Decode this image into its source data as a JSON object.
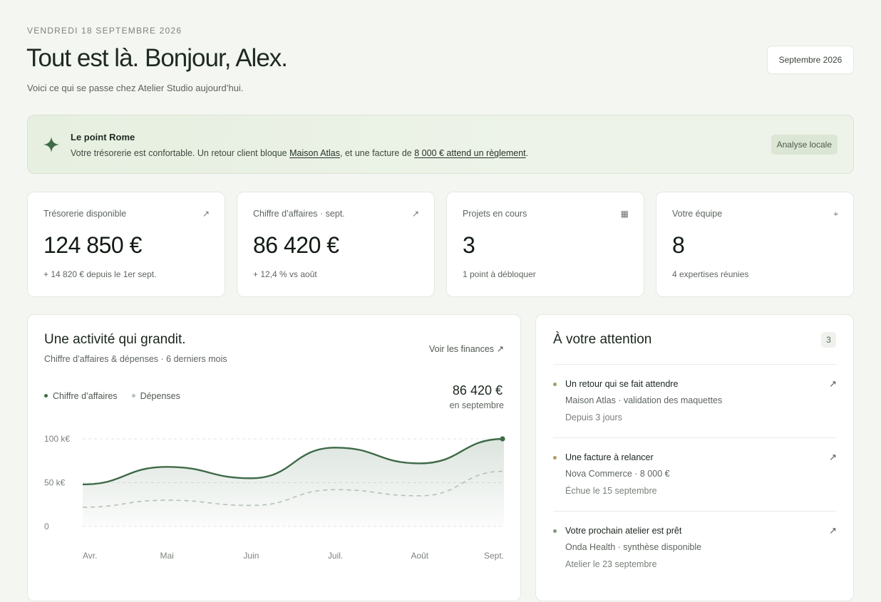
{
  "header": {
    "date": "VENDREDI 18 SEPTEMBRE 2026",
    "title": "Tout est là. Bonjour, Alex.",
    "subtitle": "Voici ce qui se passe chez Atelier Studio aujourd’hui.",
    "month_button": "Septembre 2026"
  },
  "insight": {
    "icon": "sparkle-icon",
    "title": "Le point Rome",
    "text_before": "Votre trésorerie est confortable. Un retour client bloque ",
    "link_client": "Maison Atlas",
    "text_middle": ", et une facture de ",
    "link_invoice": "8 000 € attend un règlement",
    "text_after": ".",
    "badge": "Analyse locale"
  },
  "stats": [
    {
      "label": "Trésorerie disponible",
      "icon": "↗",
      "value": "124 850 €",
      "note": "+ 14 820 € depuis le 1er sept."
    },
    {
      "label": "Chiffre d’affaires · sept.",
      "icon": "↗",
      "value": "86 420 €",
      "note": "+ 12,4 % vs août"
    },
    {
      "label": "Projets en cours",
      "icon": "▦",
      "value": "3",
      "note": "1 point à débloquer"
    },
    {
      "label": "Votre équipe",
      "icon": "⌖",
      "value": "8",
      "note": "4 expertises réunies"
    }
  ],
  "activity": {
    "title": "Une activité qui grandit.",
    "subtitle": "Chiffre d’affaires & dépenses · 6 derniers mois",
    "link": "Voir les finances ↗",
    "legend_revenue": "Chiffre d’affaires",
    "legend_expenses": "Dépenses",
    "total": "86 420 €",
    "total_sub": "en septembre"
  },
  "chart_data": {
    "type": "area",
    "categories": [
      "Avr.",
      "Mai",
      "Juin",
      "Juil.",
      "Août",
      "Sept."
    ],
    "y_ticks": [
      "0",
      "50 k€",
      "100 k€"
    ],
    "ylim": [
      0,
      100
    ],
    "series": [
      {
        "name": "Chiffre d’affaires",
        "values": [
          48,
          68,
          55,
          90,
          72,
          100
        ],
        "color": "#3e6a48"
      },
      {
        "name": "Dépenses",
        "values": [
          22,
          30,
          24,
          42,
          35,
          63
        ],
        "color": "#b3c2b3"
      }
    ],
    "grid": true,
    "legend": "top-left"
  },
  "attention": {
    "title": "À votre attention",
    "count": "3",
    "items": [
      {
        "title": "Un retour qui se fait attendre",
        "sub": "Maison Atlas · validation des maquettes",
        "meta": "Depuis 3 jours",
        "bullet": "#a49a66"
      },
      {
        "title": "Une facture à relancer",
        "sub": "Nova Commerce · 8 000 €",
        "meta": "Échue le 15 septembre",
        "bullet": "#b59a62"
      },
      {
        "title": "Votre prochain atelier est prêt",
        "sub": "Onda Health · synthèse disponible",
        "meta": "Atelier le 23 septembre",
        "bullet": "#7f9a79"
      }
    ]
  }
}
